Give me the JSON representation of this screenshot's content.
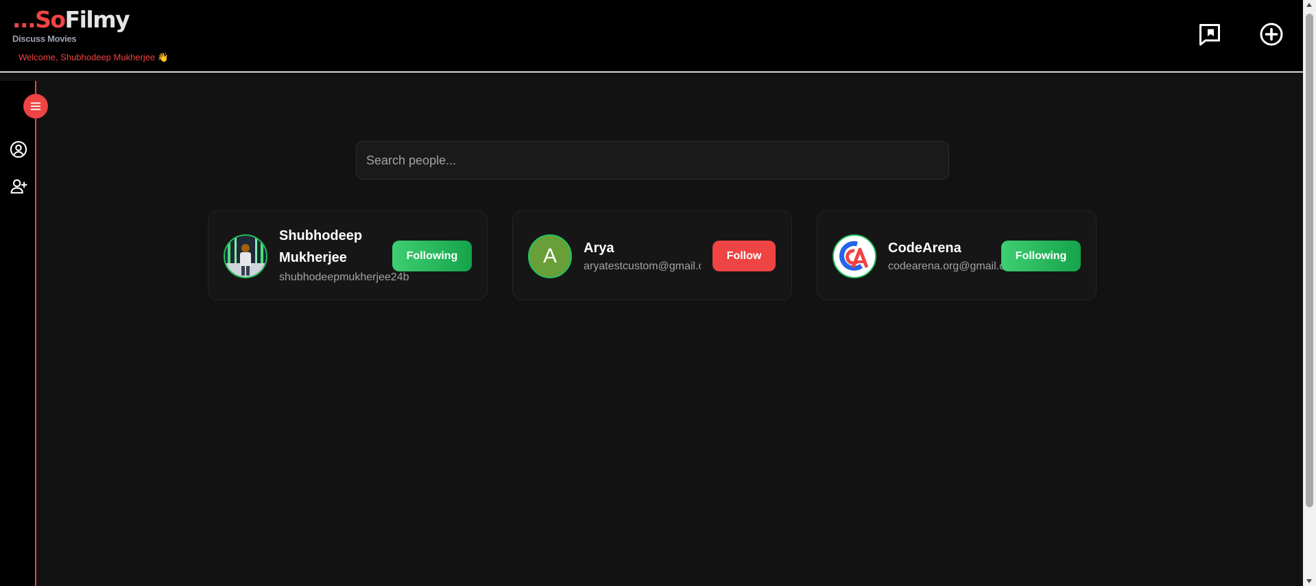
{
  "header": {
    "logo_prefix": "...So",
    "logo_suffix": "Filmy",
    "tagline": "Discuss Movies",
    "welcome": "Welcome, Shubhodeep Mukherjee 👋",
    "icons": [
      "chat-bookmark-icon",
      "add-circle-icon"
    ]
  },
  "sidebar": {
    "icons": [
      "menu-icon",
      "profile-icon",
      "add-user-icon"
    ]
  },
  "search": {
    "placeholder": "Search people..."
  },
  "people": [
    {
      "name_line1": "Shubhodeep",
      "name_line2": "Mukherjee",
      "email": "shubhodeepmukherjee24b",
      "button": "Following"
    },
    {
      "name": "Arya",
      "avatar_letter": "A",
      "email": "aryatestcustom@gmail.c",
      "button": "Follow"
    },
    {
      "name": "CodeArena",
      "email": "codearena.org@gmail.co",
      "button": "Following"
    }
  ],
  "colors": {
    "accent": "#ef4444",
    "following": "#22c55e",
    "background": "#121212"
  }
}
